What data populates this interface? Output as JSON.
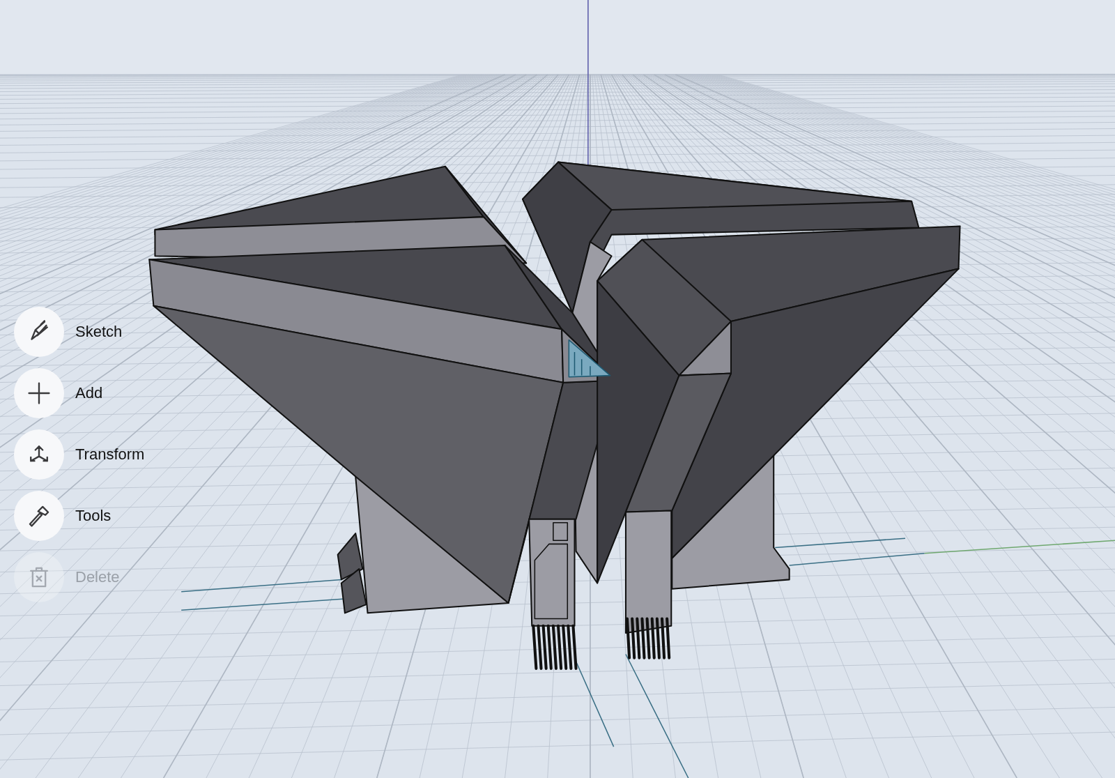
{
  "toolbar": {
    "items": [
      {
        "label": "Sketch",
        "kind": "sketch",
        "disabled": false
      },
      {
        "label": "Add",
        "kind": "add",
        "disabled": false
      },
      {
        "label": "Transform",
        "kind": "transform",
        "disabled": false
      },
      {
        "label": "Tools",
        "kind": "tools",
        "disabled": false
      },
      {
        "label": "Delete",
        "kind": "delete",
        "disabled": true
      }
    ]
  }
}
